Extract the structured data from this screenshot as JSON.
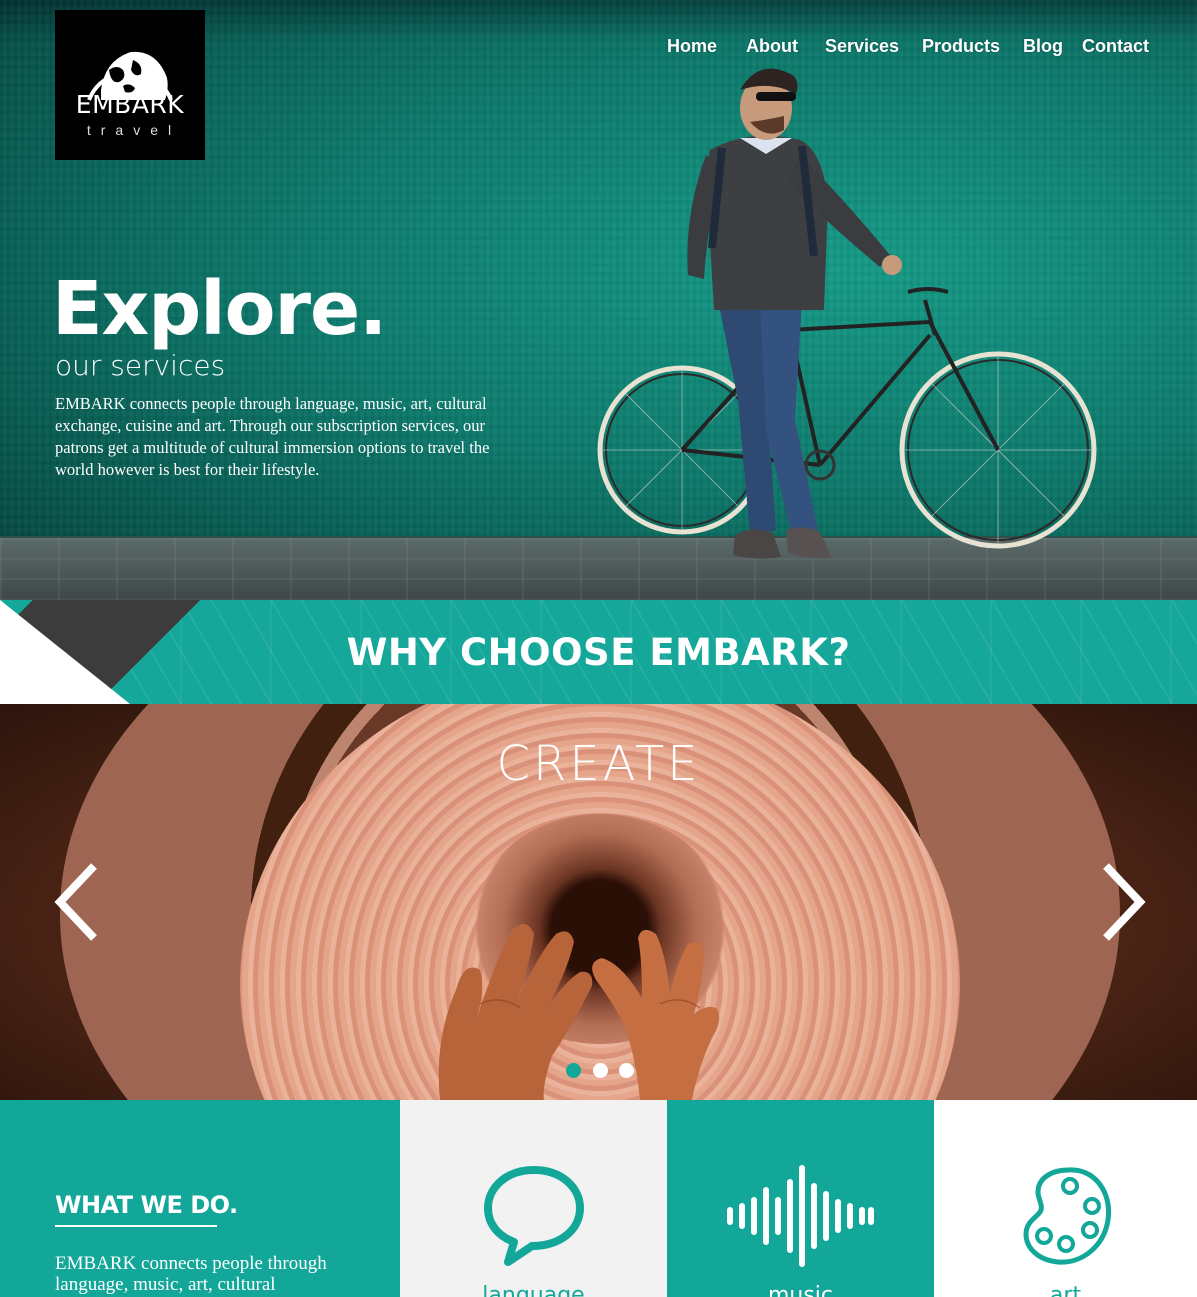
{
  "brand": {
    "name": "EMBARK",
    "tagline": "travel"
  },
  "nav": {
    "items": [
      {
        "label": "Home"
      },
      {
        "label": "About"
      },
      {
        "label": "Services"
      },
      {
        "label": "Products"
      },
      {
        "label": "Blog"
      },
      {
        "label": "Contact"
      }
    ]
  },
  "hero": {
    "title": "Explore.",
    "subtitle": "our services",
    "body": "EMBARK connects people through language, music, art, cultural exchange, cuisine and art. Through our subscription services, our patrons get a multitude of cultural immersion options to travel the world however is best for their lifestyle."
  },
  "why": {
    "title": "WHY CHOOSE EMBARK?"
  },
  "carousel": {
    "slide_title": "CREATE",
    "prev_icon": "chevron-left-icon",
    "next_icon": "chevron-right-icon",
    "slide_count": 3,
    "active_slide": 1
  },
  "what_we_do": {
    "title": "WHAT WE DO.",
    "body": "EMBARK connects people through language, music, art, cultural"
  },
  "services": [
    {
      "label": "language",
      "icon": "speech-bubble-icon"
    },
    {
      "label": "music",
      "icon": "sound-wave-icon"
    },
    {
      "label": "art",
      "icon": "palette-icon"
    }
  ],
  "colors": {
    "accent": "#13a79a",
    "dark": "#000000",
    "light_panel": "#f2f2f2"
  }
}
